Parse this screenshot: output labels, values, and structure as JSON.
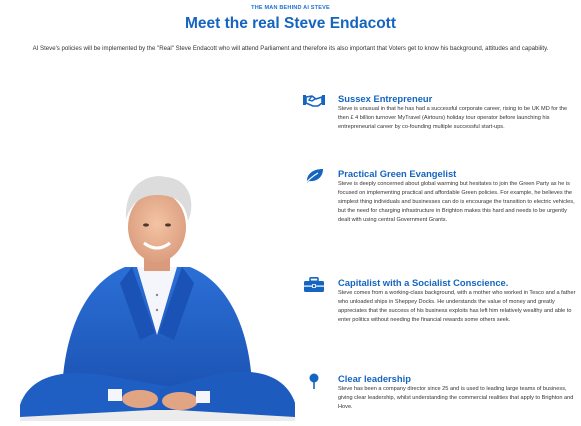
{
  "header": {
    "eyebrow": "THE MAN BEHIND AI STEVE",
    "title": "Meet the real Steve Endacott",
    "intro": "AI Steve's policies will be implemented by the \"Real\" Steve Endacott who will attend Parliament and therefore its also important that Voters get to know his background, attitudes and capability."
  },
  "features": [
    {
      "icon": "handshake-icon",
      "title": "Sussex Entrepreneur",
      "text": "Steve is unusual in that he has had a successful corporate career, rising to be UK MD for the then £ 4 billion turnover MyTravel (Airtours) holiday tour operator before launching his entrepreneurial career by co-founding multiple successful start-ups."
    },
    {
      "icon": "leaf-icon",
      "title": "Practical Green Evangelist",
      "text": "Steve is deeply concerned about global warming but hesitates to join the Green Party as he is focused on implementing practical and affordable Green policies. For example, he believes the simplest thing individuals and businesses can do is encourage the transition to electric vehicles, but the need for charging infrastructure in Brighton makes this hard and needs to be urgently dealt with using central Government Grants."
    },
    {
      "icon": "briefcase-icon",
      "title": "Capitalist with a Socialist Conscience.",
      "text": "Steve comes from a working-class background, with a mother who worked in Tesco and a father who unloaded ships in Sheppey Docks. He understands the value of money and greatly appreciates that the success of his business exploits has left him relatively wealthy and able to enter politics without needing the financial rewards some others seek."
    },
    {
      "icon": "map-pin-icon",
      "title": "Clear leadership",
      "text": "Steve has been a company director since 25 and is used to leading large teams of business, giving clear leadership, whilst understanding the commercial realities that apply to Brighton and Hove."
    }
  ],
  "colors": {
    "accent": "#1565c0",
    "eyebrow": "#1e6fd0",
    "text": "#333333",
    "suit": "#1f5fc4"
  }
}
